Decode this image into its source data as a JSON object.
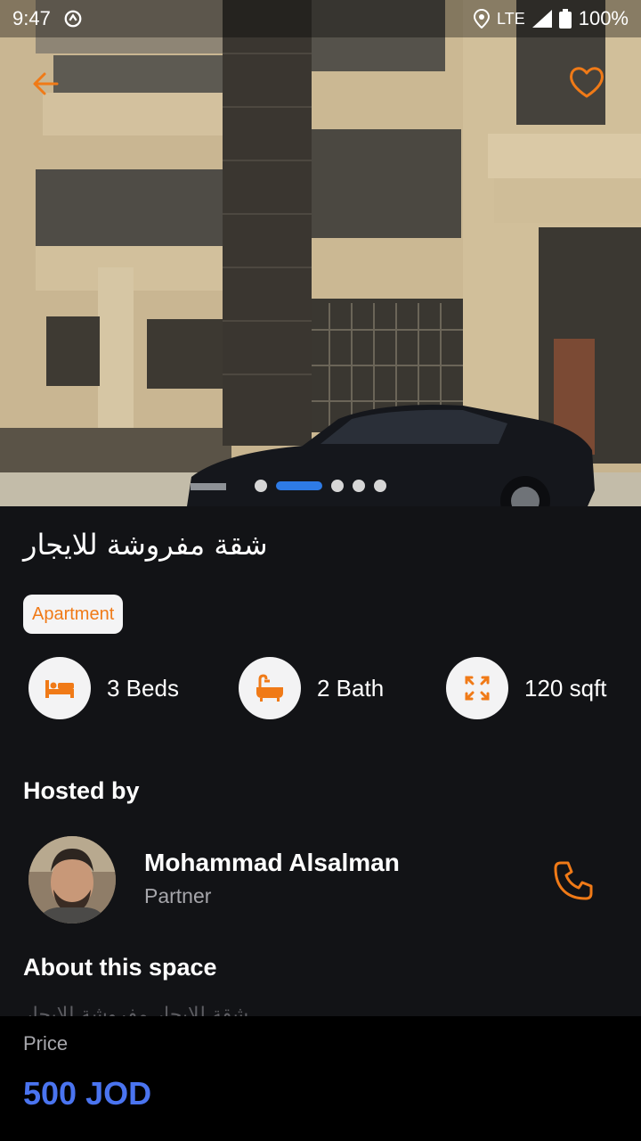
{
  "status_bar": {
    "time": "9:47",
    "network": "LTE",
    "battery": "100%"
  },
  "listing": {
    "title": "شقة مفروشة للايجار",
    "category": "Apartment",
    "features": [
      {
        "icon": "bed-icon",
        "label": "3 Beds"
      },
      {
        "icon": "bathtub-icon",
        "label": "2 Bath"
      },
      {
        "icon": "expand-icon",
        "label": "120 sqft"
      }
    ],
    "images": {
      "count": 5,
      "active_index": 1
    }
  },
  "host": {
    "heading": "Hosted by",
    "name": "Mohammad Alsalman",
    "role": "Partner"
  },
  "about": {
    "heading": "About this space",
    "text": "شقة للايجار مفروشة للايجار"
  },
  "price": {
    "label": "Price",
    "value": "500 JOD"
  },
  "colors": {
    "accent": "#f07a17",
    "price": "#4a74f0",
    "background": "#121316",
    "active_dot": "#2e7be6"
  }
}
